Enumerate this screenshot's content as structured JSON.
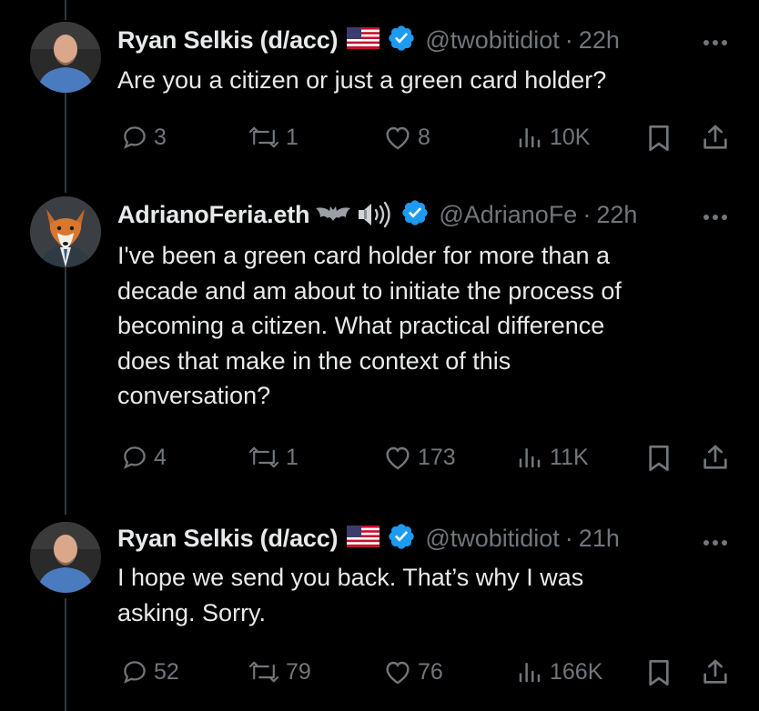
{
  "tweets": [
    {
      "name": "Ryan Selkis (d/acc)",
      "has_flag": true,
      "handle": "@twobitidiot",
      "separator": "·",
      "time": "22h",
      "text": "Are you a citizen or just a green card holder?",
      "replies": "3",
      "reposts": "1",
      "likes": "8",
      "views": "10K"
    },
    {
      "name": "AdrianoFeria.eth",
      "name_emoji": [
        "bat-icon",
        "speaker-icon"
      ],
      "handle": "@AdrianoFe",
      "separator": "·",
      "time": "22h",
      "text_lines": [
        "I've been a green card holder for more than a",
        "decade and am about to initiate the process of",
        "becoming a citizen. What practical difference",
        "does that make in the context of this",
        "conversation?"
      ],
      "replies": "4",
      "reposts": "1",
      "likes": "173",
      "views": "11K"
    },
    {
      "name": "Ryan Selkis (d/acc)",
      "has_flag": true,
      "handle": "@twobitidiot",
      "separator": "·",
      "time": "21h",
      "text_lines": [
        "I hope we send you back. That’s why I was",
        "asking. Sorry."
      ],
      "replies": "52",
      "reposts": "79",
      "likes": "76",
      "views": "166K"
    }
  ],
  "colors": {
    "background": "#000000",
    "text": "#e7e9ea",
    "secondary": "#71767b",
    "verified": "#1d9bf0",
    "thread_line": "#333639"
  }
}
